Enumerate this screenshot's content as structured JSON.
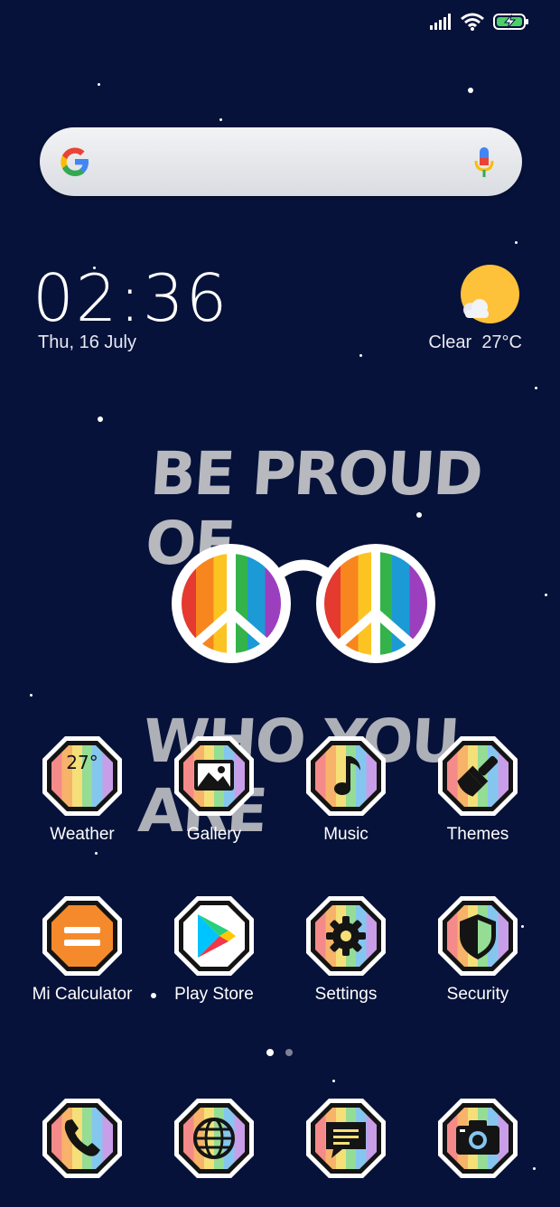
{
  "status_bar": {
    "signal_icon": "signal-icon",
    "wifi_icon": "wifi-icon",
    "battery_icon": "battery-charging-icon"
  },
  "search": {
    "logo": "google-g-icon",
    "mic": "microphone-icon"
  },
  "clock": {
    "time": "02:36",
    "date": "Thu, 16 July"
  },
  "weather_widget": {
    "condition": "Clear",
    "temperature": "27°C",
    "icon": "sun-cloud-icon"
  },
  "wallpaper": {
    "line1": "BE PROUD OF",
    "line2": "WHO YOU ARE"
  },
  "apps_row1": [
    {
      "label": "Weather",
      "badge": "27°"
    },
    {
      "label": "Gallery"
    },
    {
      "label": "Music"
    },
    {
      "label": "Themes"
    }
  ],
  "apps_row2": [
    {
      "label": "Mi Calculator"
    },
    {
      "label": "Play Store"
    },
    {
      "label": "Settings"
    },
    {
      "label": "Security"
    }
  ],
  "dock": [
    {
      "name": "phone-icon"
    },
    {
      "name": "browser-icon"
    },
    {
      "name": "messages-icon"
    },
    {
      "name": "camera-icon"
    }
  ],
  "page_indicator": {
    "pages": 2,
    "current": 1
  },
  "colors": {
    "background": "#06123a",
    "rainbow": [
      "#f27b7b",
      "#f7b36a",
      "#f5e27a",
      "#8fd98f",
      "#7fc3ef",
      "#c79be8"
    ]
  }
}
